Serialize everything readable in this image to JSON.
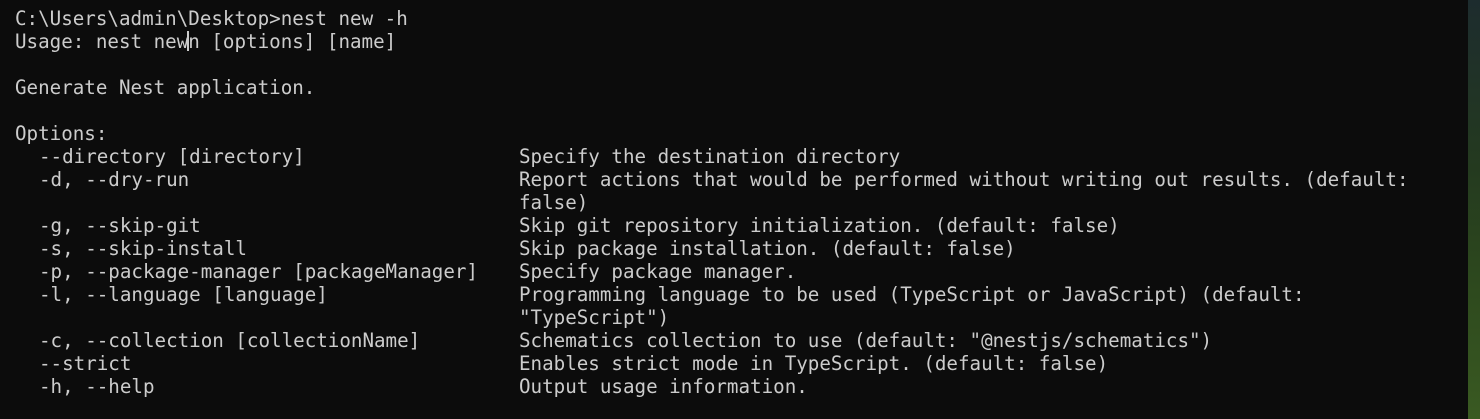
{
  "prompt": {
    "path": "C:\\Users\\admin\\Desktop>",
    "command": "nest new -h"
  },
  "usage": {
    "before_cursor": "Usage: nest new",
    "after_cursor": "n [options] [name]"
  },
  "description": "Generate Nest application.",
  "options_heading": "Options:",
  "options": [
    {
      "flag": "--directory [directory]",
      "desc": "Specify the destination directory"
    },
    {
      "flag": "-d, --dry-run",
      "desc": "Report actions that would be performed without writing out results. (default: false)"
    },
    {
      "flag": "-g, --skip-git",
      "desc": "Skip git repository initialization. (default: false)"
    },
    {
      "flag": "-s, --skip-install",
      "desc": "Skip package installation. (default: false)"
    },
    {
      "flag": "-p, --package-manager [packageManager]",
      "desc": "Specify package manager."
    },
    {
      "flag": "-l, --language [language]",
      "desc": "Programming language to be used (TypeScript or JavaScript) (default: \"TypeScript\")"
    },
    {
      "flag": "-c, --collection [collectionName]",
      "desc": "Schematics collection to use (default: \"@nestjs/schematics\")"
    },
    {
      "flag": "--strict",
      "desc": "Enables strict mode in TypeScript. (default: false)"
    },
    {
      "flag": "-h, --help",
      "desc": "Output usage information."
    }
  ]
}
